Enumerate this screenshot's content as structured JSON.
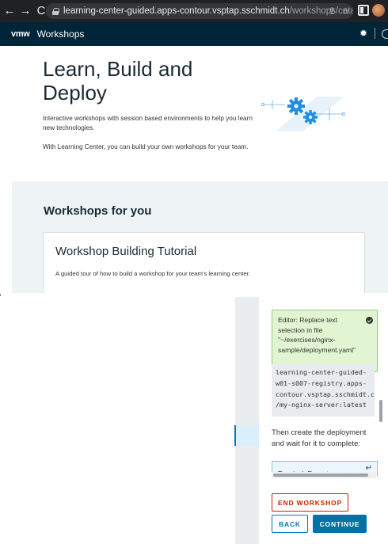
{
  "browser": {
    "url_host": "learning-center-guided.apps-contour.vsptap.sschmidt.ch",
    "url_path": "/workshops/catalog/"
  },
  "app": {
    "logo": "vmw",
    "title": "Workshops"
  },
  "hero": {
    "title": "Learn, Build and Deploy",
    "paragraph1": "Interactive workshops with session based environments to help you learn new technologies.",
    "paragraph2": "With Learning Center, you can build your own workshops for your team."
  },
  "workshops_section": {
    "heading": "Workshops for you",
    "card": {
      "title": "Workshop Building Tutorial",
      "description": "A guided tour of how to build a workshop for your team's learning center."
    }
  },
  "instructions": {
    "editor_action": "Editor: Replace text selection in file \"~/exercises/nginx-sample/deployment.yaml\"",
    "code": "learning-center-guided-\nw01-s007-registry.apps-\ncontour.vsptap.sschmidt.ch\n/my-nginx-server:latest",
    "paragraph": "Then create the deployment and wait for it to complete:",
    "terminal_action": "Terminal: Execute"
  },
  "buttons": {
    "end_workshop": "END WORKSHOP",
    "back": "BACK",
    "continue": "CONTINUE"
  },
  "colors": {
    "header_bg": "#002538",
    "section_bg": "#eef3f6",
    "success_bg": "#e1f5d2",
    "danger": "#c92100",
    "primary": "#0072a3"
  }
}
